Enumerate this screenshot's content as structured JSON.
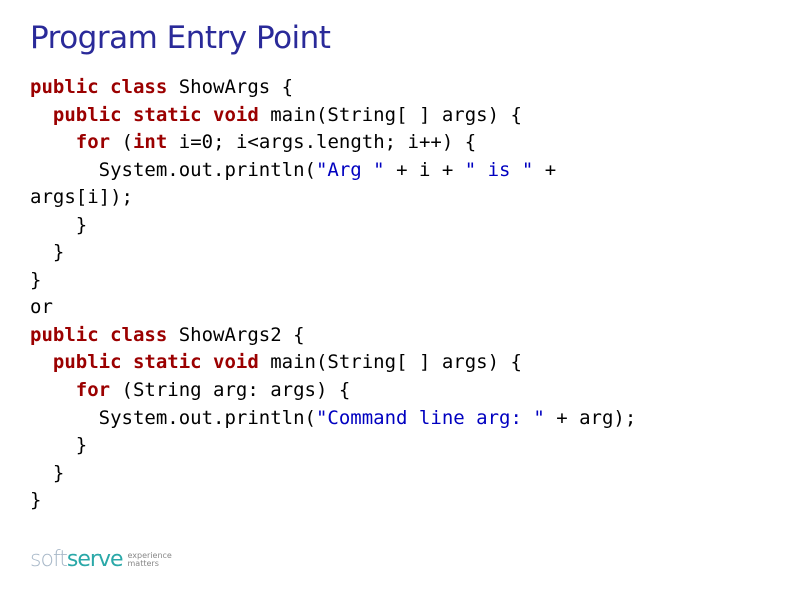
{
  "title": "Program Entry Point",
  "code": {
    "l1_kw1": "public class",
    "l1_txt": " ShowArgs {",
    "l2_kw1": "public static void",
    "l2_txt": " main(String[ ] args) {",
    "l3_kw1": "for",
    "l3_txt1": " (",
    "l3_kw2": "int",
    "l3_txt2": " i=0; i<args.length; i++) {",
    "l4_txt1": "      System.out.println(",
    "l4_str1": "\"Arg \"",
    "l4_txt2": " + i + ",
    "l4_str2": "\" is \"",
    "l4_txt3": " +",
    "l5_txt": "args[i]);",
    "l6_txt": "    }",
    "l7_txt": "  }",
    "l8_txt": "}",
    "l9_txt": "or",
    "l10_kw1": "public class",
    "l10_txt": " ShowArgs2 {",
    "l11_kw1": "public static void",
    "l11_txt": " main(String[ ] args) {",
    "l12_kw1": "for",
    "l12_txt": " (String arg: args) {",
    "l13_txt1": "      System.out.println(",
    "l13_str1": "\"Command line arg: \"",
    "l13_txt2": " + arg);",
    "l14_txt": "    }",
    "l15_txt": "  }",
    "l16_txt": "}"
  },
  "footer": {
    "logo_soft": "soft",
    "logo_serve": "serve",
    "tagline_top": "experience",
    "tagline_bot": "matters"
  }
}
